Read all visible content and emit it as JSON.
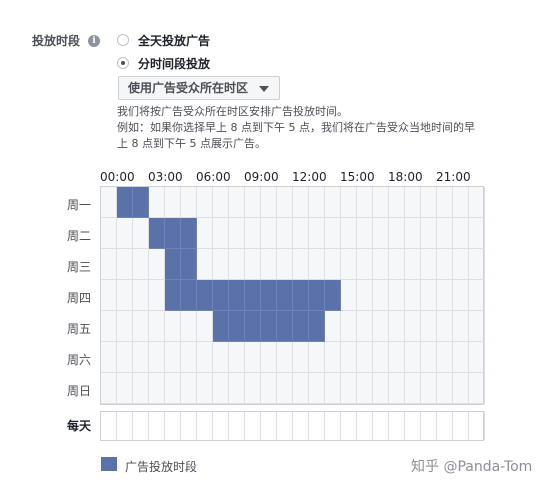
{
  "schedule": {
    "label": "投放时段",
    "options": [
      {
        "label": "全天投放广告",
        "selected": false
      },
      {
        "label": "分时间段投放",
        "selected": true
      }
    ],
    "timezone_dropdown": "使用广告受众所在时区",
    "description_lines": [
      "我们将按广告受众所在时区安排广告投放时间。",
      "例如：如果你选择早上 8 点到下午 5 点，我们将在广告受众当地时间的早",
      "上 8 点到下午 5 点展示广告。"
    ]
  },
  "grid": {
    "hour_labels": [
      "00:00",
      "03:00",
      "06:00",
      "09:00",
      "12:00",
      "15:00",
      "18:00",
      "21:00"
    ],
    "days": [
      "周一",
      "周二",
      "周三",
      "周四",
      "周五",
      "周六",
      "周日"
    ],
    "everyday_label": "每天",
    "selected_hours": {
      "周一": [
        1,
        2
      ],
      "周二": [
        3,
        4,
        5
      ],
      "周三": [
        4,
        5
      ],
      "周四": [
        4,
        5,
        6,
        7,
        8,
        9,
        10,
        11,
        12,
        13,
        14
      ],
      "周五": [
        7,
        8,
        9,
        10,
        11,
        12,
        13
      ],
      "周六": [],
      "周日": []
    },
    "selected_color": "#5b71a9"
  },
  "legend": {
    "label": "广告投放时段"
  },
  "watermark": "知乎 @Panda-Tom"
}
